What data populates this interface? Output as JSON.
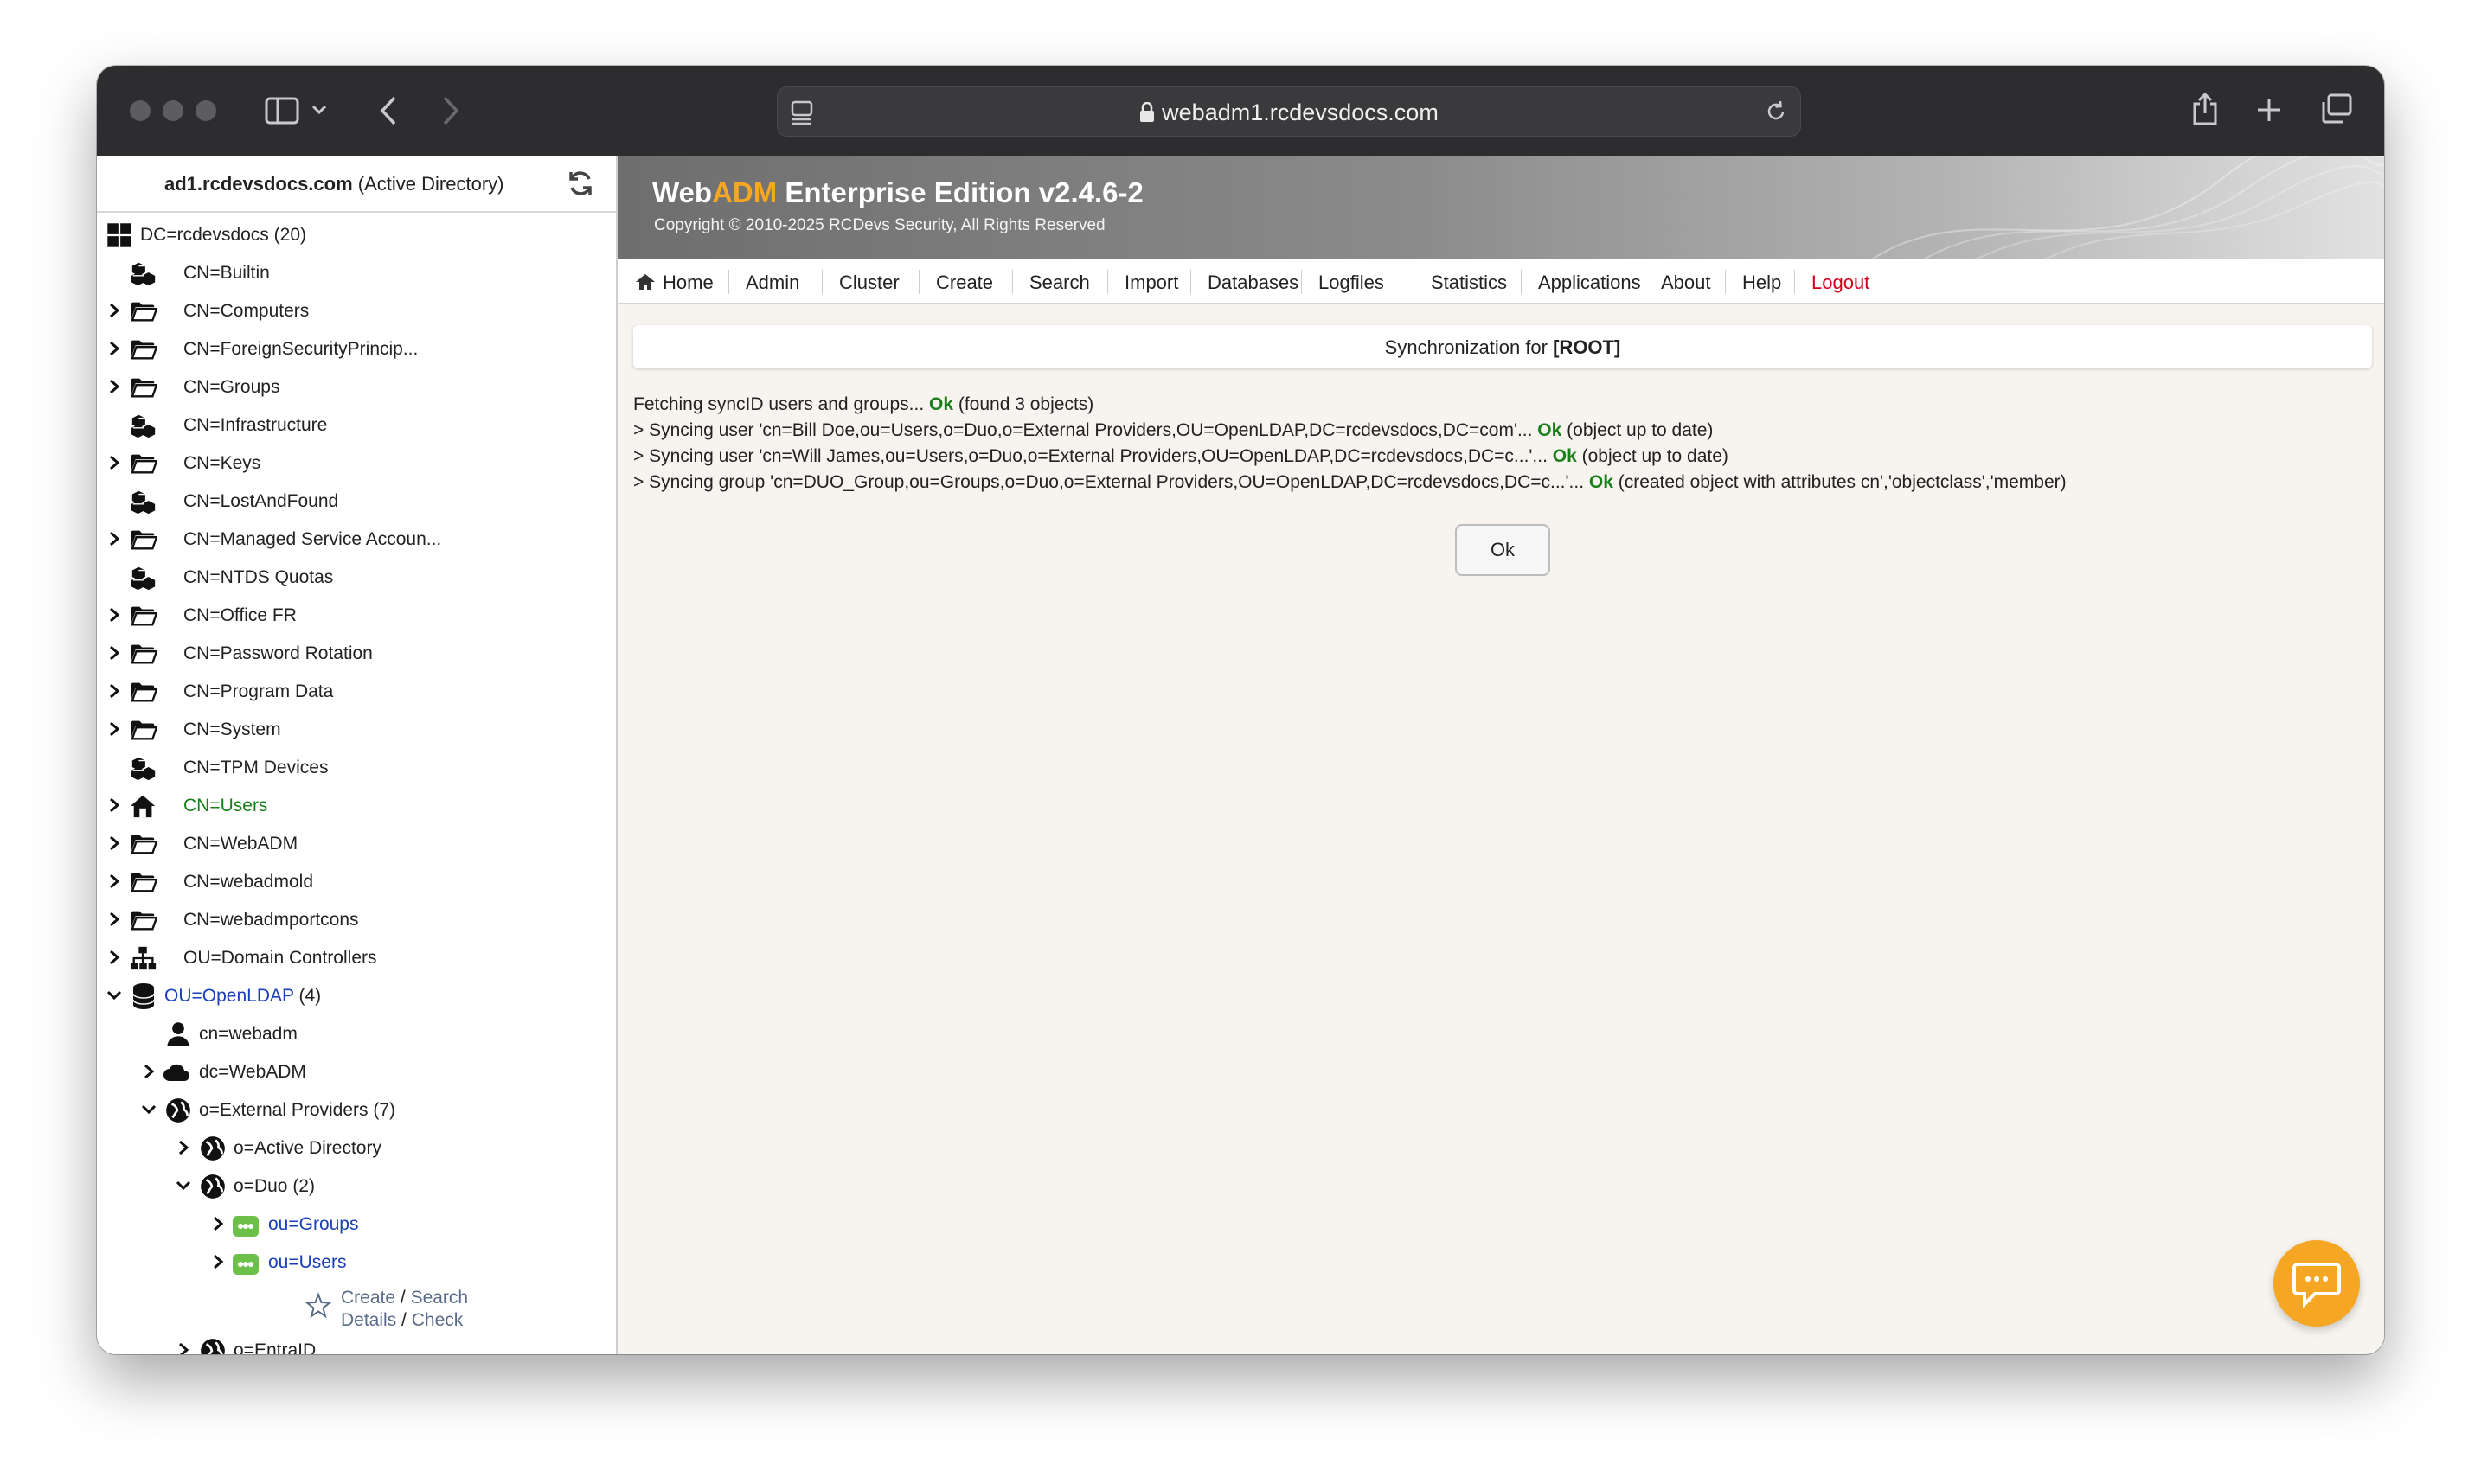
{
  "browser": {
    "url": "webadm1.rcdevsdocs.com"
  },
  "sidebar": {
    "server": "ad1.rcdevsdocs.com",
    "server_type": "(Active Directory)",
    "root": {
      "label": "DC=rcdevsdocs",
      "count": "(20)"
    },
    "items": [
      {
        "label": "CN=Builtin",
        "icon": "container-icon",
        "expandable": false
      },
      {
        "label": "CN=Computers",
        "icon": "folder-icon",
        "expandable": true
      },
      {
        "label": "CN=ForeignSecurityPrincip...",
        "icon": "folder-icon",
        "expandable": true
      },
      {
        "label": "CN=Groups",
        "icon": "folder-icon",
        "expandable": true
      },
      {
        "label": "CN=Infrastructure",
        "icon": "container-icon",
        "expandable": false
      },
      {
        "label": "CN=Keys",
        "icon": "folder-icon",
        "expandable": true
      },
      {
        "label": "CN=LostAndFound",
        "icon": "container-icon",
        "expandable": false
      },
      {
        "label": "CN=Managed Service Accoun...",
        "icon": "folder-icon",
        "expandable": true
      },
      {
        "label": "CN=NTDS Quotas",
        "icon": "container-icon",
        "expandable": false
      },
      {
        "label": "CN=Office FR",
        "icon": "folder-icon",
        "expandable": true
      },
      {
        "label": "CN=Password Rotation",
        "icon": "folder-icon",
        "expandable": true
      },
      {
        "label": "CN=Program Data",
        "icon": "folder-icon",
        "expandable": true
      },
      {
        "label": "CN=System",
        "icon": "folder-icon",
        "expandable": true
      },
      {
        "label": "CN=TPM Devices",
        "icon": "container-icon",
        "expandable": false
      },
      {
        "label": "CN=Users",
        "icon": "home-icon",
        "expandable": true
      },
      {
        "label": "CN=WebADM",
        "icon": "folder-icon",
        "expandable": true
      },
      {
        "label": "CN=webadmold",
        "icon": "folder-icon",
        "expandable": true
      },
      {
        "label": "CN=webadmportcons",
        "icon": "folder-icon",
        "expandable": true
      },
      {
        "label": "OU=Domain Controllers",
        "icon": "sitemap-icon",
        "expandable": true
      }
    ],
    "openldap": {
      "label": "OU=OpenLDAP",
      "count": "(4)"
    },
    "openldap_children": {
      "webadm_user": "cn=webadm",
      "dc_webadm": "dc=WebADM",
      "external_providers": "o=External Providers",
      "external_providers_count": "(7)",
      "active_directory": "o=Active Directory",
      "duo": "o=Duo",
      "duo_count": "(2)",
      "ou_groups": "ou=Groups",
      "ou_users": "ou=Users",
      "create": "Create",
      "slash": "/",
      "search": "Search",
      "details": "Details",
      "check": "Check",
      "entraid": "o=EntraID"
    }
  },
  "banner": {
    "brand_web": "Web",
    "brand_adm": "ADM",
    "edition": " Enterprise Edition v2.4.6-2",
    "copyright": "Copyright © 2010-2025 RCDevs Security, All Rights Reserved"
  },
  "nav": {
    "items": [
      "Home",
      "Admin",
      "Cluster",
      "Create",
      "Search",
      "Import",
      "Databases",
      "Logfiles",
      "Statistics",
      "Applications",
      "About",
      "Help"
    ],
    "logout": "Logout"
  },
  "panel": {
    "title_prefix": "Synchronization for ",
    "title_target": "[ROOT]"
  },
  "log": [
    {
      "pre": "Fetching syncID users and groups... ",
      "status": "Ok",
      "post": " (found 3 objects)"
    },
    {
      "pre": "> Syncing user 'cn=Bill Doe,ou=Users,o=Duo,o=External Providers,OU=OpenLDAP,DC=rcdevsdocs,DC=com'... ",
      "status": "Ok",
      "post": " (object up to date)"
    },
    {
      "pre": "> Syncing user 'cn=Will James,ou=Users,o=Duo,o=External Providers,OU=OpenLDAP,DC=rcdevsdocs,DC=c...'... ",
      "status": "Ok",
      "post": " (object up to date)"
    },
    {
      "pre": "> Syncing group 'cn=DUO_Group,ou=Groups,o=Duo,o=External Providers,OU=OpenLDAP,DC=rcdevsdocs,DC=c...'... ",
      "status": "Ok",
      "post": " (created object with attributes cn','objectclass','member)"
    }
  ],
  "ok_button": "Ok",
  "colors": {
    "accent_orange": "#f5a623",
    "ok_green": "#1a7f1a",
    "logout_red": "#d0021b",
    "ldap_blue": "#1a3fb8"
  }
}
